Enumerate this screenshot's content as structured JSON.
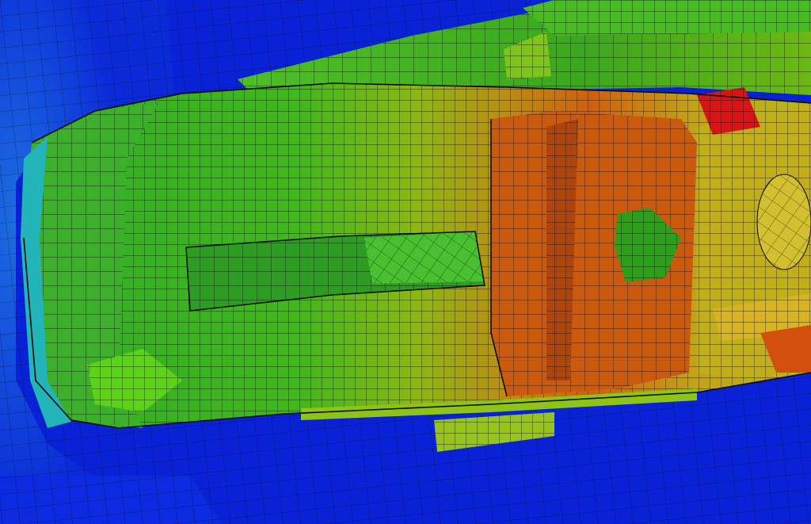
{
  "palette": {
    "background": "#0a1fd0",
    "deep_blue": "#0a22dc",
    "light_blue": "#1c6fe0",
    "cyan": "#18b6c8",
    "green": "#2fb81e",
    "light_green": "#5ccc12",
    "yellow_green": "#9cc40c",
    "olive": "#b6b214",
    "orange": "#d0600c",
    "dark_orange": "#b04a08",
    "red": "#e01010",
    "mesh_line": "#0a0a0a"
  },
  "contour_bands": [
    "deep_blue",
    "light_blue",
    "cyan",
    "green",
    "light_green",
    "yellow_green",
    "olive",
    "orange",
    "red"
  ]
}
